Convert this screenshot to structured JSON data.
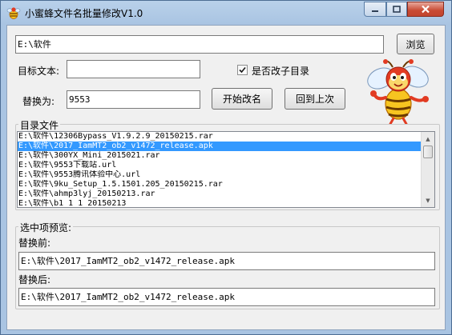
{
  "window": {
    "title": "小蜜蜂文件名批量修改V1.0",
    "controls": {
      "minimize": "—",
      "maximize": "□",
      "close": "✕"
    }
  },
  "form": {
    "path_value": "E:\\软件",
    "browse_label": "浏览",
    "target_label": "目标文本:",
    "target_value": "",
    "change_subdir_label": "是否改子目录",
    "change_subdir_checked": true,
    "replace_label": "替换为:",
    "replace_value": "9553",
    "start_label": "开始改名",
    "undo_label": "回到上次"
  },
  "file_list": {
    "legend": "目录文件",
    "selected_index": 1,
    "items": [
      "E:\\软件\\12306Bypass_V1.9.2.9_20150215.rar",
      "E:\\软件\\2017_IamMT2_ob2_v1472_release.apk",
      "E:\\软件\\300YX_Mini_2015021.rar",
      "E:\\软件\\9553下载站.url",
      "E:\\软件\\9553腾讯体验中心.url",
      "E:\\软件\\9ku_Setup_1.5.1501.205_20150215.rar",
      "E:\\软件\\ahmp3lyj_20150213.rar",
      "E:\\软件\\b1_1_1  20150213"
    ]
  },
  "preview": {
    "legend": "选中项预览:",
    "before_label": "替换前:",
    "before_value": "E:\\软件\\2017_IamMT2_ob2_v1472_release.apk",
    "after_label": "替换后:",
    "after_value": "E:\\软件\\2017_IamMT2_ob2_v1472_release.apk"
  },
  "icons": {
    "app": "bee-icon",
    "mascot": "bee-mascot-illustration"
  },
  "colors": {
    "selection": "#3399ff",
    "title_gradient_top": "#b9d1ea",
    "close_button": "#c84a33",
    "bee_yellow": "#f7c520",
    "bee_red": "#e23b22"
  }
}
